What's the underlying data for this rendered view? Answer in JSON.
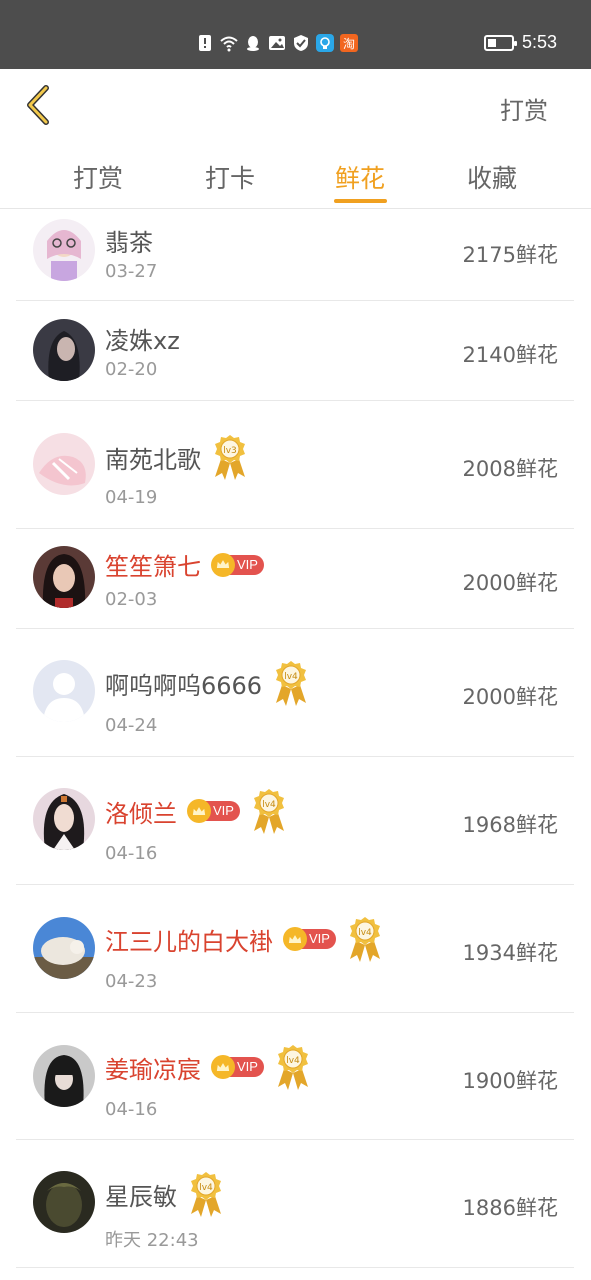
{
  "status_bar": {
    "time": "5:53",
    "icons": [
      "sim-alert-icon",
      "wifi-icon",
      "qq-icon",
      "gallery-icon",
      "shield-icon",
      "bulb-app-icon",
      "taobao-icon"
    ],
    "taobao_label": "淘",
    "battery_level": 0.3
  },
  "header": {
    "action_label": "打赏"
  },
  "tabs": [
    {
      "label": "打赏",
      "active": false
    },
    {
      "label": "打卡",
      "active": false
    },
    {
      "label": "鲜花",
      "active": true
    },
    {
      "label": "收藏",
      "active": false
    }
  ],
  "colors": {
    "accent": "#f0a020",
    "vip_name": "#d9432f",
    "vip_badge": "#e3534e",
    "gold": "#f5b728"
  },
  "vip_label": "VIP",
  "list": [
    {
      "name": "翡茶",
      "date": "03-27",
      "amount": "2175鲜花",
      "vip": false,
      "level": null
    },
    {
      "name": "凌姝xz",
      "date": "02-20",
      "amount": "2140鲜花",
      "vip": false,
      "level": null
    },
    {
      "name": "南苑北歌",
      "date": "04-19",
      "amount": "2008鲜花",
      "vip": false,
      "level": "lv3"
    },
    {
      "name": "笙笙箫七",
      "date": "02-03",
      "amount": "2000鲜花",
      "vip": true,
      "level": null
    },
    {
      "name": "啊呜啊呜6666",
      "date": "04-24",
      "amount": "2000鲜花",
      "vip": false,
      "level": "lv4"
    },
    {
      "name": "洛倾兰",
      "date": "04-16",
      "amount": "1968鲜花",
      "vip": true,
      "level": "lv4"
    },
    {
      "name": "江三儿的白大褂",
      "date": "04-23",
      "amount": "1934鲜花",
      "vip": true,
      "level": "lv4"
    },
    {
      "name": "姜瑜凉宸",
      "date": "04-16",
      "amount": "1900鲜花",
      "vip": true,
      "level": "lv4"
    },
    {
      "name": "星辰敏",
      "date": "昨天 22:43",
      "amount": "1886鲜花",
      "vip": false,
      "level": "lv4"
    }
  ]
}
